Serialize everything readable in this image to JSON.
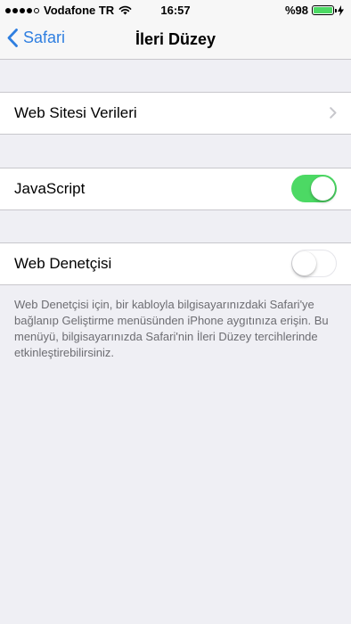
{
  "status_bar": {
    "carrier": "Vodafone TR",
    "time": "16:57",
    "battery_percent_text": "%98",
    "battery_level": 0.98,
    "signal_bars_filled": 4,
    "signal_bars_total": 5
  },
  "nav": {
    "back_label": "Safari",
    "title": "İleri Düzey"
  },
  "rows": {
    "website_data": "Web Sitesi Verileri",
    "javascript": "JavaScript",
    "web_inspector": "Web Denetçisi"
  },
  "toggles": {
    "javascript_on": true,
    "web_inspector_on": false
  },
  "footer": {
    "web_inspector_note": "Web Denetçisi için, bir kabloyla bilgisayarınızdaki Safari'ye bağlanıp Geliştirme menüsünden iPhone aygıtınıza erişin. Bu menüyü, bilgisayarınızda Safari'nin İleri Düzey tercihlerinde etkinleştirebilirsiniz."
  },
  "colors": {
    "accent": "#2f7fe0",
    "toggle_on": "#4cd964",
    "background": "#efeff4",
    "footer_text": "#6d6d72"
  }
}
